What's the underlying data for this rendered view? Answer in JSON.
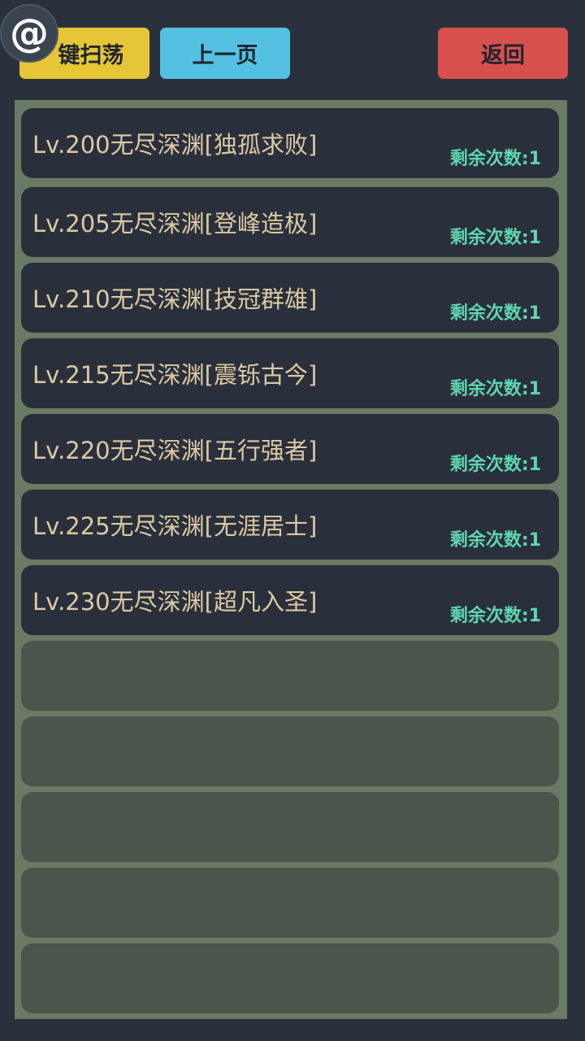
{
  "toolbar": {
    "sweep_label": "一键扫荡",
    "sweep_visible_label": "键扫荡",
    "prev_label": "上一页",
    "back_label": "返回"
  },
  "overlay": {
    "icon": "at-icon",
    "glyph": "@"
  },
  "colors": {
    "background": "#2b313c",
    "sweep_button": "#e6c636",
    "prev_button": "#55c1e2",
    "back_button": "#d7504c",
    "frame": "#6b7a63",
    "item_filled": "#2a303b",
    "item_empty": "#4a564c",
    "title_text": "#dcc9a3",
    "remaining_text": "#5fd6b0"
  },
  "list": {
    "items": [
      {
        "title": "Lv.200无尽深渊[独孤求败]",
        "remaining": "剩余次数:1"
      },
      {
        "title": "Lv.205无尽深渊[登峰造极]",
        "remaining": "剩余次数:1"
      },
      {
        "title": "Lv.210无尽深渊[技冠群雄]",
        "remaining": "剩余次数:1"
      },
      {
        "title": "Lv.215无尽深渊[震铄古今]",
        "remaining": "剩余次数:1"
      },
      {
        "title": "Lv.220无尽深渊[五行强者]",
        "remaining": "剩余次数:1"
      },
      {
        "title": "Lv.225无尽深渊[无涯居士]",
        "remaining": "剩余次数:1"
      },
      {
        "title": "Lv.230无尽深渊[超凡入圣]",
        "remaining": "剩余次数:1"
      }
    ],
    "empty_slots": 5
  }
}
